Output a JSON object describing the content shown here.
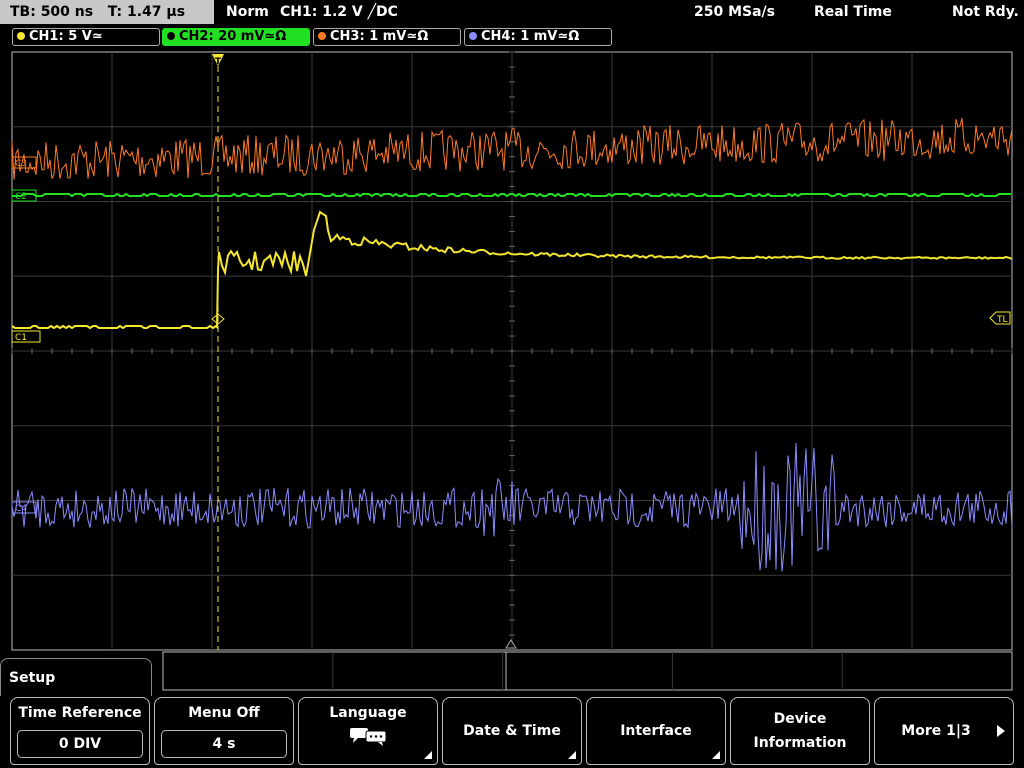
{
  "status_bar": {
    "timebase": "TB: 500 ns",
    "trigger_time": "T: 1.47 µs",
    "trigger_mode": "Norm",
    "trigger_info": "CH1: 1.2 V ╱DC",
    "sample_rate": "250 MSa/s",
    "acq_mode": "Real Time",
    "state": "Not Rdy."
  },
  "channels": [
    {
      "label": "CH1: 5 V≃",
      "color": "#f5e62e",
      "active": false
    },
    {
      "label": "CH2: 20 mV≃Ω",
      "color": "#21e021",
      "active": true
    },
    {
      "label": "CH3: 1 mV≃Ω",
      "color": "#ff7a20",
      "active": false
    },
    {
      "label": "CH4: 1 mV≃Ω",
      "color": "#8c8cff",
      "active": false
    }
  ],
  "markers": {
    "c1": "C1",
    "c2": "C2",
    "c3": "C3",
    "c4": "C4",
    "trigger_level": "TL",
    "trigger_position": "T"
  },
  "menu": {
    "title": "Setup",
    "softkeys": [
      {
        "title": "Time Reference",
        "value": "0 DIV"
      },
      {
        "title": "Menu Off",
        "value": "4 s"
      },
      {
        "title": "Language"
      },
      {
        "title": "Date & Time"
      },
      {
        "title": "Interface"
      },
      {
        "title": "Device",
        "title2": "Information"
      },
      {
        "title": "More 1|3"
      }
    ]
  }
}
